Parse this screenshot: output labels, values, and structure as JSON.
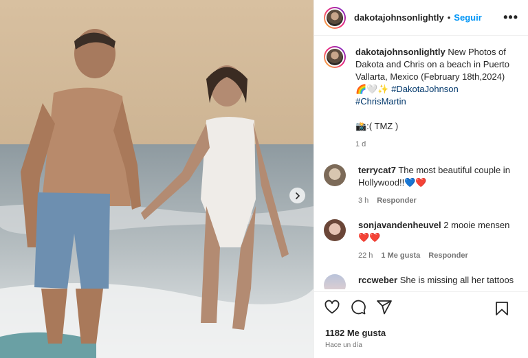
{
  "post": {
    "username": "dakotajohnsonlightly",
    "separator": "•",
    "follow_label": "Seguir",
    "more_label": "•••",
    "next_label": "›"
  },
  "caption": {
    "username": "dakotajohnsonlightly",
    "text_1": "New Photos of Dakota and Chris on a beach in Puerto Vallarta, Mexico (February 18th,2024)",
    "emoji": "🌈🤍✨",
    "hashtag_1": "#DakotaJohnson",
    "hashtag_2": "#ChrisMartin",
    "credit": "📸:( TMZ )",
    "time": "1 d"
  },
  "comments": [
    {
      "username": "terrycat7",
      "text": "The most beautiful couple in Hollywood!!💙❤️",
      "time": "3 h",
      "likes": "",
      "reply": "Responder"
    },
    {
      "username": "sonjavandenheuvel",
      "text": "2 mooie mensen❤️❤️",
      "time": "22 h",
      "likes": "1 Me gusta",
      "reply": "Responder"
    },
    {
      "username": "rccweber",
      "text": "She is missing all her tattoos",
      "time": "",
      "likes": "",
      "reply": ""
    }
  ],
  "footer": {
    "likes": "1182 Me gusta",
    "ago": "Hace un día"
  },
  "icons": [
    "heart-icon",
    "comment-icon",
    "share-icon",
    "bookmark-icon",
    "chevron-right-icon",
    "more-icon"
  ],
  "colors": {
    "link": "#00376b",
    "follow": "#0095f6",
    "muted": "#737373"
  }
}
